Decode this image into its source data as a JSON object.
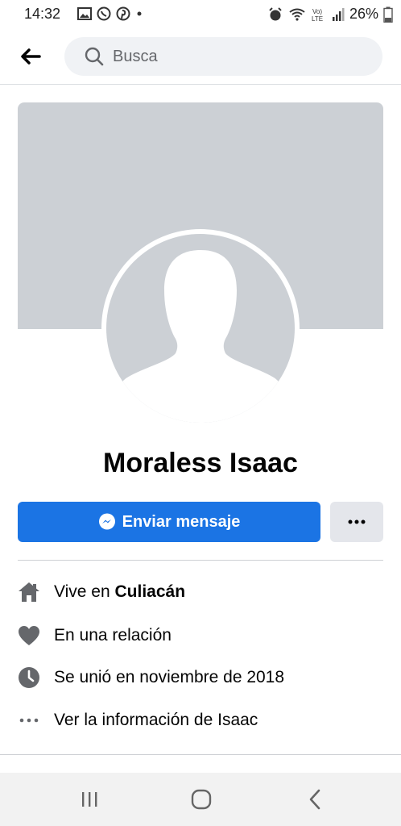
{
  "status_bar": {
    "time": "14:32",
    "notification_icons": [
      "image-icon",
      "whatsapp-icon",
      "pinterest-icon",
      "dot-icon"
    ],
    "right_icons": [
      "alarm-icon",
      "wifi-icon",
      "volte-icon",
      "signal-icon"
    ],
    "battery": "26%"
  },
  "header": {
    "search_placeholder": "Busca"
  },
  "profile": {
    "name": "Moraless Isaac"
  },
  "actions": {
    "message_label": "Enviar mensaje",
    "more_label": "···"
  },
  "info": {
    "lives_prefix": "Vive en ",
    "lives_city": "Culiacán",
    "relationship": "En una relación",
    "joined": "Se unió en noviembre de 2018",
    "see_info": "Ver la información de Isaac"
  },
  "colors": {
    "accent": "#1b74e4",
    "placeholder_gray": "#ccd0d5"
  }
}
